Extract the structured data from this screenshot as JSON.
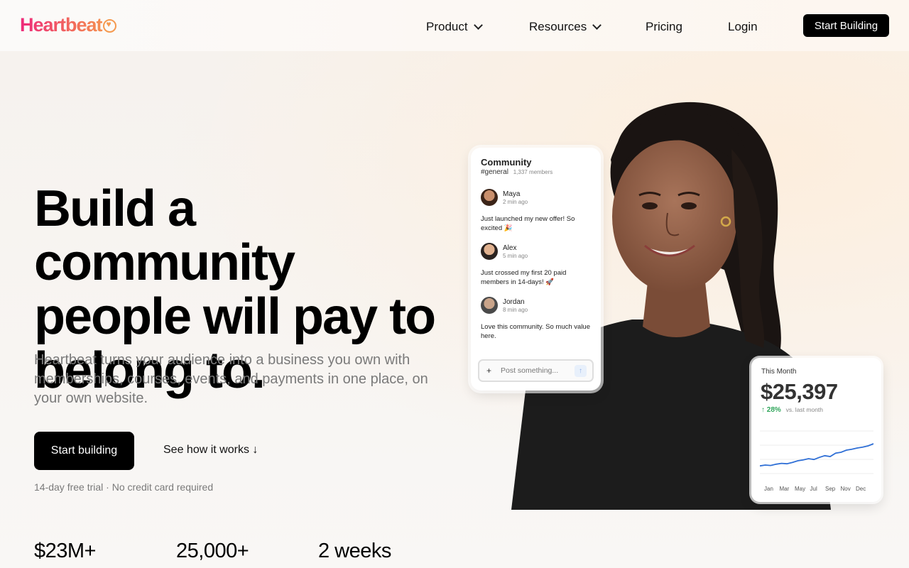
{
  "header": {
    "logo_text": "Heartbeat",
    "nav": {
      "product": "Product",
      "resources": "Resources",
      "pricing": "Pricing",
      "login": "Login"
    },
    "cta": "Start Building"
  },
  "hero": {
    "headline_line1": "Build a community",
    "headline_line2": "people will pay to",
    "headline_line3": "belong to.",
    "subhead": "Heartbeat turns your audience into a business you own with memberships, courses, events, and payments in one place, on your own website.",
    "primary_cta": "Start building",
    "secondary_cta": "See how it works ↓",
    "fine_print": "14-day free trial · No credit card required"
  },
  "stats": [
    "$23M+",
    "25,000+",
    "2 weeks"
  ],
  "community_card": {
    "title": "Community",
    "channel": "#general",
    "members": "1,337 members",
    "messages": [
      {
        "name": "Maya",
        "time": "2 min ago",
        "text": "Just launched my new offer! So excited 🎉"
      },
      {
        "name": "Alex",
        "time": "5 min ago",
        "text": "Just crossed my first 20 paid members in 14-days! 🚀"
      },
      {
        "name": "Jordan",
        "time": "8 min ago",
        "text": "Love this community. So much value here."
      }
    ],
    "post_placeholder": "Post something...",
    "send_icon": "arrow-up-icon"
  },
  "revenue_card": {
    "label": "This Month",
    "amount": "$25,397",
    "change": "↑ 28%",
    "change_note": "vs. last month",
    "change_color": "#2fa55a",
    "line_color": "#2f6fd6",
    "months": [
      "Jan",
      "Mar",
      "May",
      "Jul",
      "Sep",
      "Nov",
      "Dec"
    ],
    "trend": [
      0.18,
      0.2,
      0.19,
      0.22,
      0.24,
      0.23,
      0.26,
      0.3,
      0.32,
      0.35,
      0.33,
      0.38,
      0.42,
      0.4,
      0.48,
      0.5,
      0.55,
      0.57,
      0.6,
      0.62,
      0.65,
      0.7
    ]
  },
  "colors": {
    "brand_gradient_start": "#ee2a7b",
    "brand_gradient_end": "#f6a04d",
    "primary_button": "#000000"
  }
}
